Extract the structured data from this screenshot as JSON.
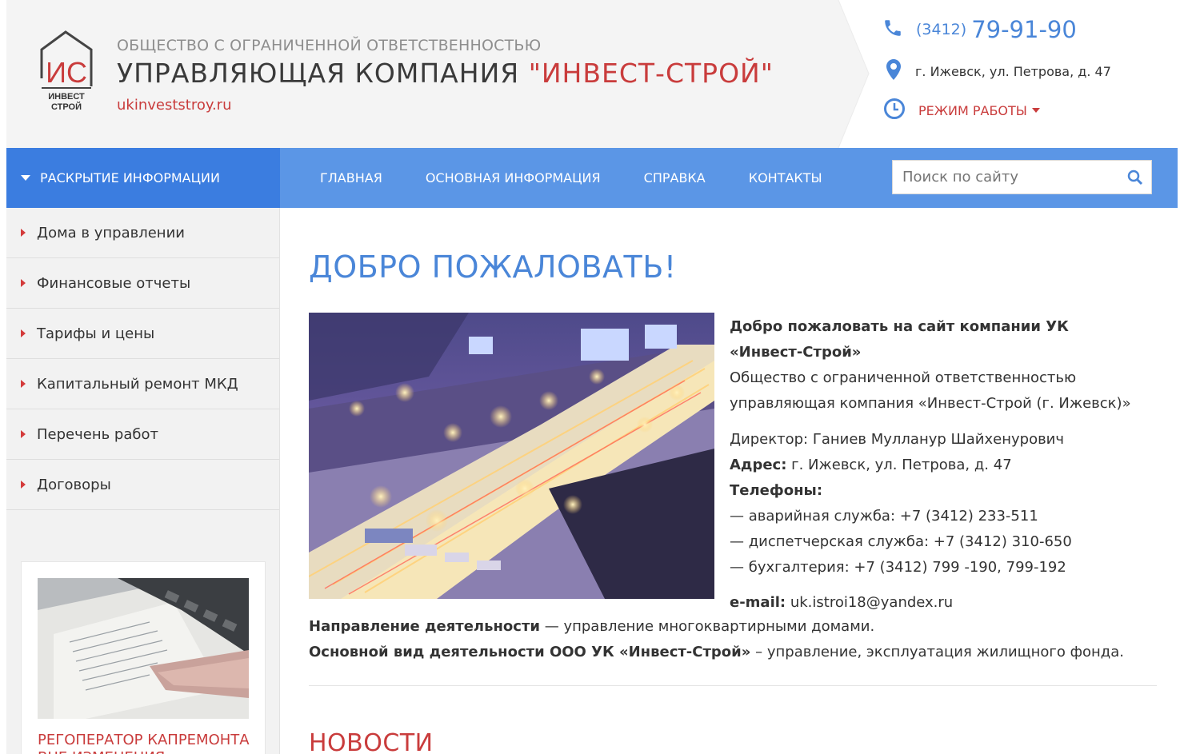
{
  "header": {
    "logo_letters": "ИС",
    "logo_sub1": "ИНВЕСТ",
    "logo_sub2": "СТРОЙ",
    "org_type": "ОБЩЕСТВО С ОГРАНИЧЕННОЙ ОТВЕТСТВЕННОСТЬЮ",
    "company_prefix": "УПРАВЛЯЮЩАЯ КОМПАНИЯ ",
    "company_brand": "\"ИНВЕСТ-СТРОЙ\"",
    "site_url": "ukinveststroy.ru",
    "phone_prefix": "(3412)",
    "phone_number": "79-91-90",
    "address": "г. Ижевск, ул. Петрова, д. 47",
    "hours_label": "РЕЖИМ РАБОТЫ"
  },
  "nav": {
    "disclosure_label": "РАСКРЫТИЕ ИНФОРМАЦИИ",
    "links": [
      "ГЛАВНАЯ",
      "ОСНОВНАЯ ИНФОРМАЦИЯ",
      "СПРАВКА",
      "КОНТАКТЫ"
    ],
    "search_placeholder": "Поиск по сайту"
  },
  "sidebar": {
    "items": [
      {
        "label": "Дома в управлении"
      },
      {
        "label": "Финансовые отчеты"
      },
      {
        "label": "Тарифы и цены"
      },
      {
        "label": "Капитальный ремонт МКД"
      },
      {
        "label": "Перечень работ"
      },
      {
        "label": "Договоры"
      }
    ],
    "promo_title": "РЕГОПЕРАТОР КАПРЕМОНТА ВНЕ ИЗМЕНЕНИЯ СТОИМОСТИ"
  },
  "content": {
    "welcome_title": "ДОБРО ПОЖАЛОВАТЬ!",
    "intro_bold": "Добро пожаловать на сайт компании УК «Инвест-Строй»",
    "intro_text": "Общество с ограниченной ответственностью управляющая компания «Инвест-Строй (г. Ижевск)»",
    "director": "Директор: Ганиев Мулланур Шайхенурович",
    "address_label": "Адрес:",
    "address_value": " г. Ижевск, ул. Петрова, д. 47",
    "phones_label": "Телефоны:",
    "phone_emergency": "— аварийная служба: +7 (3412) 233-511",
    "phone_dispatch": "— диспетчерская служба: +7 (3412) 310-650",
    "phone_accounting": "— бухгалтерия: +7 (3412) 799 -190, 799-192",
    "email_label": "e-mail:",
    "email_value": " uk.istroi18@yandex.ru",
    "direction_label": "Направление деятельности",
    "direction_value": " — управление многоквартирными домами.",
    "main_activity_label": "Основной вид деятельности ООО УК «Инвест-Строй»",
    "main_activity_value": " – управление, эксплуатация жилищного фонда.",
    "news_title": "НОВОСТИ"
  },
  "colors": {
    "accent_blue": "#4a86d8",
    "nav_blue": "#5b96e6",
    "nav_dark_blue": "#3b7de0",
    "brand_red": "#c93c3c"
  },
  "icons": [
    "phone-icon",
    "map-pin-icon",
    "clock-icon",
    "search-icon",
    "caret-down-icon"
  ]
}
